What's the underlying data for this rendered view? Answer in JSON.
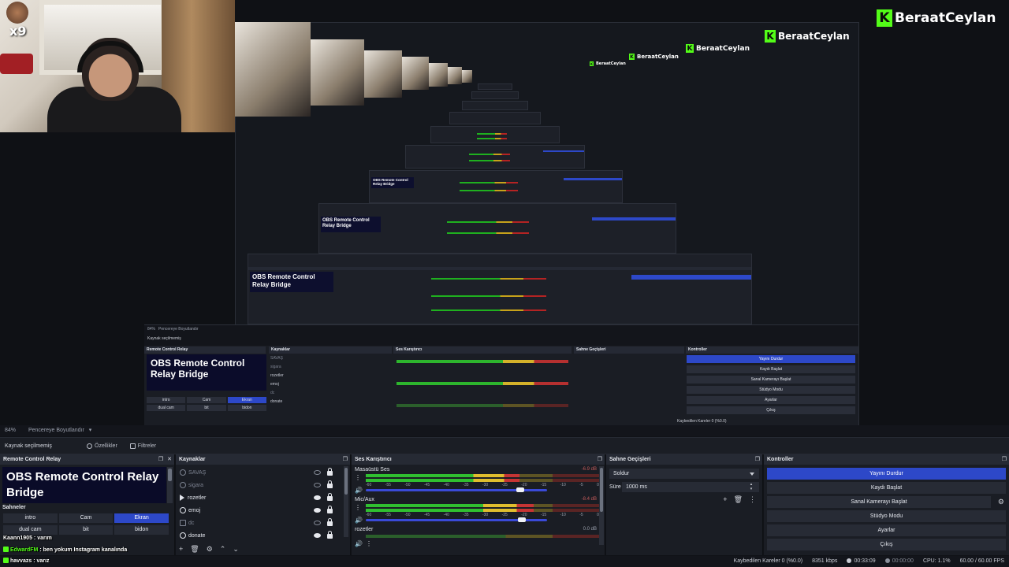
{
  "brand": {
    "letter": "K",
    "name": "BeraatCeylan"
  },
  "overlay": {
    "multiplier": "x9"
  },
  "nested_preview": {
    "relay_title": "OBS Remote Control Relay Bridge",
    "panel_titles": [
      "Remote Control Relay",
      "Kaynaklar",
      "Ses Karıştırıcı",
      "Sahne Geçişleri",
      "Kontroller"
    ],
    "scenes": [
      "intro",
      "Cam",
      "Ekran",
      "dual cam",
      "bit",
      "bidon"
    ],
    "sources": [
      "SAVAŞ",
      "sigara",
      "rozetler",
      "emoj",
      "dc",
      "donate"
    ],
    "controls": [
      "Yayını Durdur",
      "Kaydı Başlat",
      "Sanal Kamerayı Başlat",
      "Stüdyo Modu",
      "Ayarlar",
      "Çıkış"
    ],
    "zoom": "84%",
    "window_mode": "Pencereye Boyutlandır",
    "no_source": "Kaynak seçilmemiş",
    "status": "Kaybedilen Kareler 0 (%0.0)"
  },
  "topstrip": {
    "zoom": "84%",
    "window_mode": "Pencereye Boyutlandır"
  },
  "toolbar": {
    "no_source": "Kaynak seçilmemiş",
    "properties": "Özellikler",
    "filters": "Filtreler"
  },
  "docks": {
    "relay": {
      "title": "Remote Control Relay",
      "box_text": "OBS Remote Control Relay Bridge"
    },
    "scenes": {
      "title": "Sahneler",
      "items": [
        {
          "label": "intro",
          "active": false
        },
        {
          "label": "Cam",
          "active": false
        },
        {
          "label": "Ekran",
          "active": true
        },
        {
          "label": "dual cam",
          "active": false
        },
        {
          "label": "bit",
          "active": false
        },
        {
          "label": "bidon",
          "active": false
        }
      ]
    },
    "sources": {
      "title": "Kaynaklar",
      "items": [
        {
          "label": "SAVAŞ",
          "visible": false
        },
        {
          "label": "sigara",
          "visible": false
        },
        {
          "label": "rozetler",
          "visible": true
        },
        {
          "label": "emoj",
          "visible": true
        },
        {
          "label": "dc",
          "visible": false
        },
        {
          "label": "donate",
          "visible": true
        }
      ]
    },
    "mixer": {
      "title": "Ses Karıştırıcı",
      "channels": [
        {
          "name": "Masaüstü Ses",
          "db": "-6.9 dB",
          "level": 0.66,
          "fader": 0.85
        },
        {
          "name": "Mic/Aux",
          "db": "-8.4 dB",
          "level": 0.72,
          "fader": 0.86
        },
        {
          "name": "rozetler",
          "db": "0.0 dB",
          "level": 0,
          "fader": 1.0
        }
      ],
      "scale": [
        "-60",
        "-55",
        "-50",
        "-45",
        "-40",
        "-35",
        "-30",
        "-25",
        "-20",
        "-15",
        "-10",
        "-5",
        "0"
      ]
    },
    "transitions": {
      "title": "Sahne Geçişleri",
      "selected": "Soldur",
      "duration_label": "Süre",
      "duration_value": "1000 ms"
    },
    "controls": {
      "title": "Kontroller",
      "buttons": [
        "Yayını Durdur",
        "Kaydı Başlat",
        "Sanal Kamerayı Başlat",
        "Stüdyo Modu",
        "Ayarlar",
        "Çıkış"
      ]
    }
  },
  "chat": [
    {
      "user": "Kaann1905",
      "sep": " : ",
      "msg": "varım",
      "color": "#ffffff"
    },
    {
      "user": "EdwardFM",
      "sep": " : ",
      "msg": "ben yokum Instagram kanalında",
      "color": "#53fc18"
    },
    {
      "user": "havvazs",
      "sep": " : ",
      "msg": "varız",
      "color": "#ffffff"
    }
  ],
  "status": {
    "dropped": "Kaybedilen Kareler 0 (%0.0)",
    "bitrate": "8351 kbps",
    "live_time": "00:33:09",
    "rec_time": "00:00:00",
    "cpu": "CPU: 1.1%",
    "fps": "60.00 / 60.00 FPS"
  },
  "colors": {
    "accent": "#2d48c8",
    "brand": "#53fc18",
    "relay_bg": "#0a0b28"
  }
}
